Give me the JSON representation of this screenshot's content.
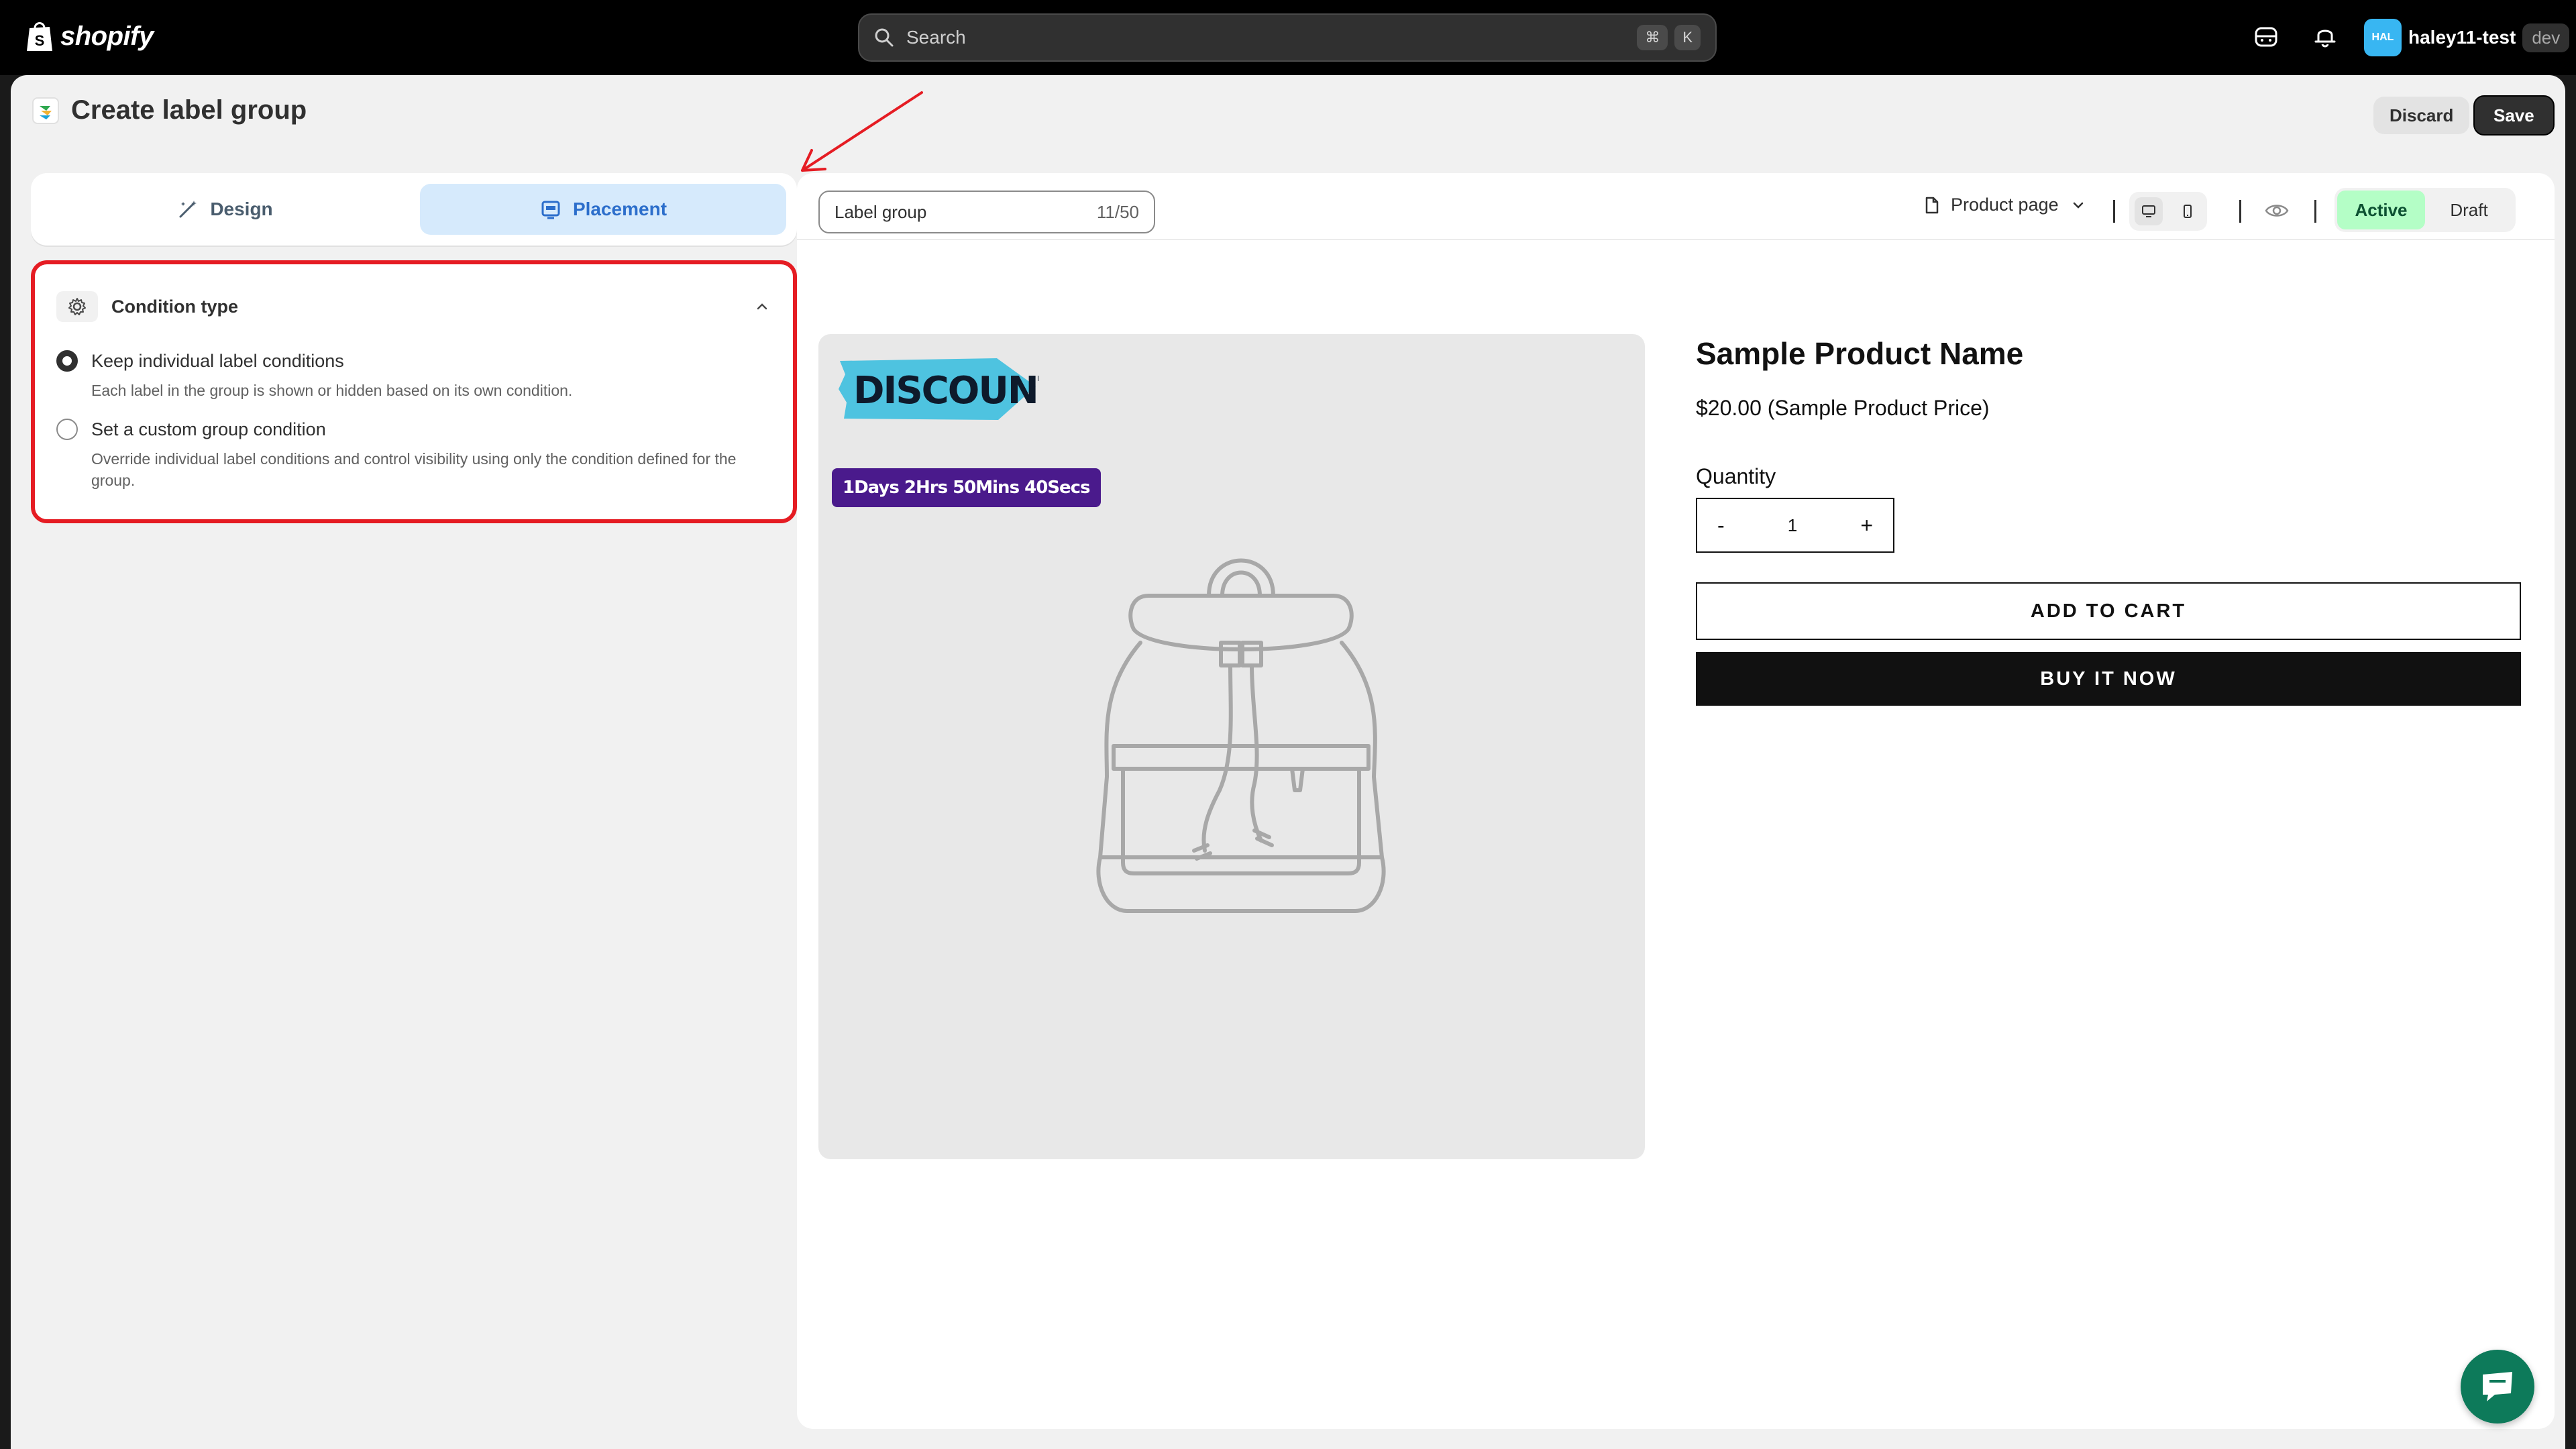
{
  "topbar": {
    "brand": "shopify",
    "search_placeholder": "Search",
    "shortcut": [
      "⌘",
      "K"
    ],
    "user_initials": "HAL",
    "user_name": "haley11-test",
    "store_badge": "dev"
  },
  "header": {
    "title": "Create label group",
    "discard_label": "Discard",
    "save_label": "Save"
  },
  "tabs": [
    {
      "label": "Design",
      "icon": "wand-icon",
      "active": false
    },
    {
      "label": "Placement",
      "icon": "layout-icon",
      "active": true
    }
  ],
  "condition": {
    "title": "Condition type",
    "options": [
      {
        "label": "Keep individual label conditions",
        "description": "Each label in the group is shown or hidden based on its own condition.",
        "selected": true
      },
      {
        "label": "Set a custom group condition",
        "description": "Override individual label conditions and control visibility using only the condition defined for the group.",
        "selected": false
      }
    ]
  },
  "toolbar": {
    "group_name": "Label group",
    "char_count": "11/50",
    "page": "Product page",
    "status_active": "Active",
    "status_draft": "Draft",
    "active_status": "Active"
  },
  "preview": {
    "discount_text": "DISCOUNT",
    "timer": "1Days 2Hrs 50Mins 40Secs",
    "product_name": "Sample Product Name",
    "price": "$20.00 (Sample Product Price)",
    "quantity_label": "Quantity",
    "qty_minus": "-",
    "qty_value": "1",
    "qty_plus": "+",
    "add_to_cart": "ADD TO CART",
    "buy_now": "BUY IT NOW"
  },
  "colors": {
    "highlight_border": "#e51c23",
    "active_tab": "#d6eafc",
    "active_status": "#b4fec6",
    "timer_bg": "#4a1a8c",
    "discount_bg": "#4ec3e0"
  }
}
